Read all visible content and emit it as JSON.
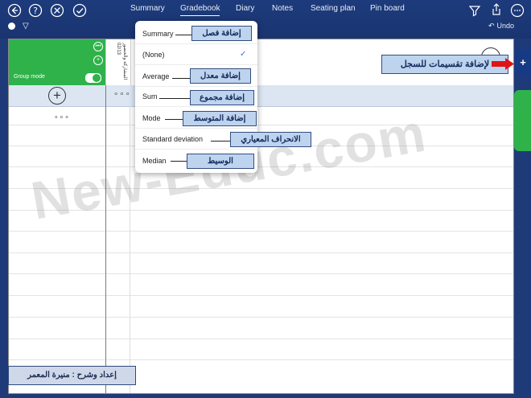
{
  "toolbar": {
    "left_icons": [
      "back-arrow-icon",
      "help-icon",
      "tools-icon",
      "check-icon"
    ],
    "tabs": [
      {
        "label": "Summary",
        "active": false
      },
      {
        "label": "Gradebook",
        "active": true
      },
      {
        "label": "Diary",
        "active": false
      },
      {
        "label": "Notes",
        "active": false
      },
      {
        "label": "Seating plan",
        "active": false
      },
      {
        "label": "Pin board",
        "active": false
      }
    ],
    "right_icons": [
      "filter-icon",
      "share-icon",
      "more-icon"
    ],
    "undo_label": "Undo"
  },
  "student_panel": {
    "group_mode_label": "Group mode",
    "group_mode_on": true
  },
  "column_header": {
    "title": "المشاركة والحضور",
    "date": "02/13"
  },
  "summary_menu": {
    "items": [
      "Summary",
      "(None)",
      "Average",
      "Sum",
      "Mode",
      "Standard deviation",
      "Median"
    ],
    "selected": "(None)"
  },
  "callouts": {
    "add_chapter": "إضافة فصل",
    "add_average": "إضافة معدل",
    "add_sum": "إضافة مجموع",
    "add_mode": "إضافة المتوسط",
    "std_dev": "الانحراف المعياري",
    "median": "الوسيط",
    "add_sections": "لإضافة تقسيمات للسجل"
  },
  "author_credit": "إعداد وشرح : منيرة المعمر",
  "watermark_text": "New-Educ.com",
  "colors": {
    "nav_blue": "#1d3b7c",
    "group_green": "#2fb24a",
    "callout_fill": "#bed3ee",
    "arrow_red": "#e01414"
  }
}
